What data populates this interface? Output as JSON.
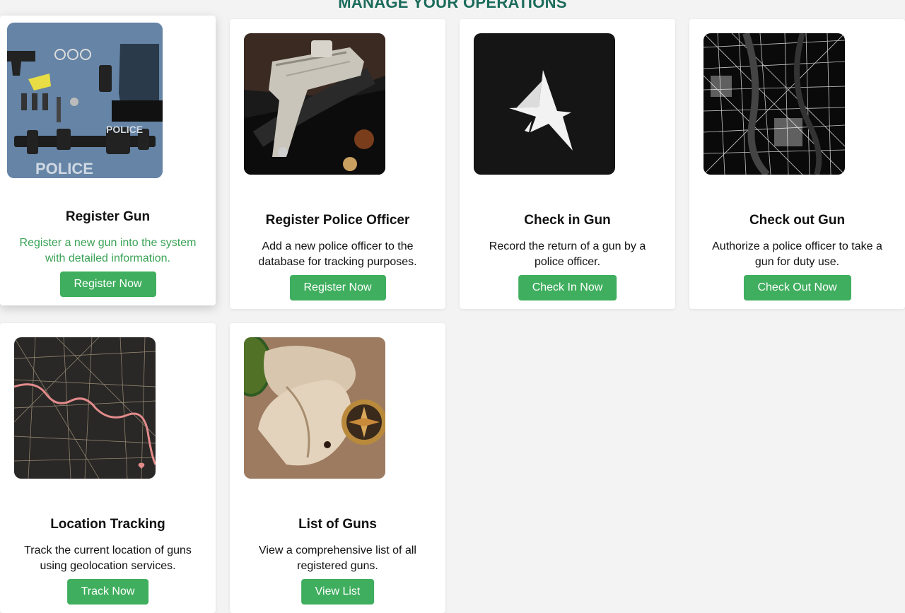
{
  "page": {
    "heading": "MANAGE YOUR OPERATIONS"
  },
  "colors": {
    "heading": "#1a6b5a",
    "button": "#3fae5e",
    "hover_text": "#3aa356",
    "background": "#f3f3f3"
  },
  "cards": [
    {
      "title": "Register Gun",
      "description": "Register a new gun into the system with detailed information.",
      "button": "Register Now",
      "image": "police-gear-flatlay-image",
      "state": "hovered"
    },
    {
      "title": "Register Police Officer",
      "description": "Add a new police officer to the database for tracking purposes.",
      "button": "Register Now",
      "image": "engraved-pistol-image",
      "state": "default"
    },
    {
      "title": "Check in Gun",
      "description": "Record the return of a gun by a police officer.",
      "button": "Check In Now",
      "image": "star-logo-image",
      "state": "default"
    },
    {
      "title": "Check out Gun",
      "description": "Authorize a police officer to take a gun for duty use.",
      "button": "Check Out Now",
      "image": "city-map-image",
      "state": "default"
    },
    {
      "title": "Location Tracking",
      "description": "Track the current location of guns using geolocation services.",
      "button": "Track Now",
      "image": "dark-street-map-image",
      "state": "default"
    },
    {
      "title": "List of Guns",
      "description": "View a comprehensive list of all registered guns.",
      "button": "View List",
      "image": "old-map-compass-image",
      "state": "default"
    }
  ]
}
